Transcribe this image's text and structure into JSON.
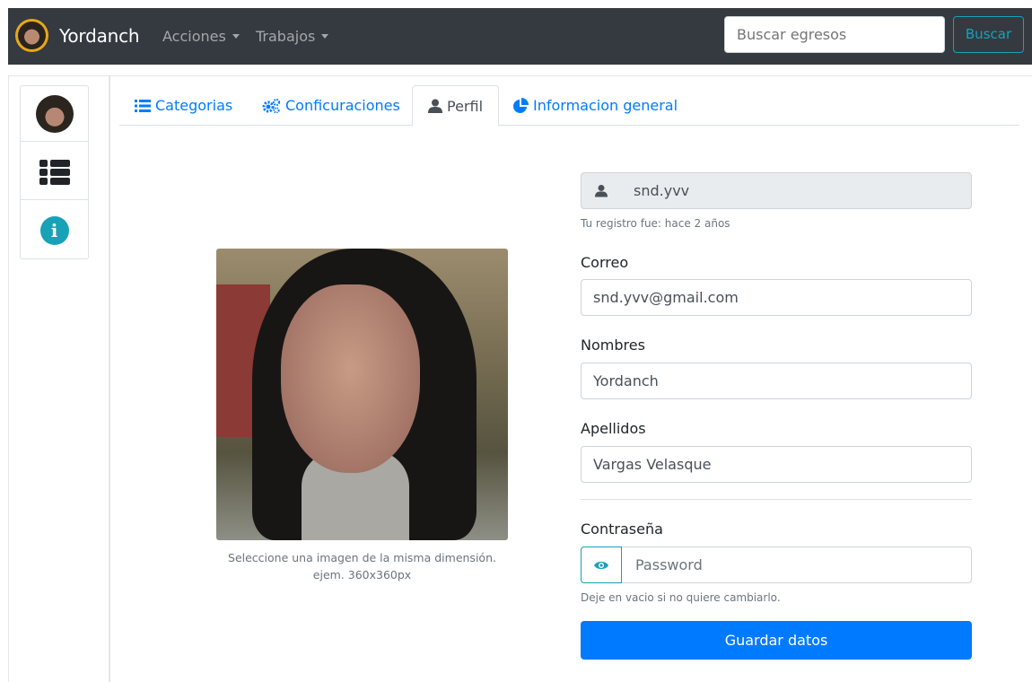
{
  "navbar": {
    "brand": "Yordanch",
    "menus": [
      {
        "label": "Acciones"
      },
      {
        "label": "Trabajos"
      }
    ],
    "search": {
      "placeholder": "Buscar egresos",
      "button_label": "Buscar"
    }
  },
  "sidebar": {
    "items": [
      {
        "icon": "user-avatar"
      },
      {
        "icon": "list-icon"
      },
      {
        "icon": "info-icon"
      }
    ]
  },
  "tabs": [
    {
      "label": "Categorias",
      "icon": "list-icon",
      "active": false
    },
    {
      "label": "Conficuraciones",
      "icon": "gears-icon",
      "active": false
    },
    {
      "label": "Perfil",
      "icon": "user-icon",
      "active": true
    },
    {
      "label": "Informacion general",
      "icon": "pie-chart-icon",
      "active": false
    }
  ],
  "profile": {
    "photo_caption_line1": "Seleccione una imagen de la misma dimensión.",
    "photo_caption_line2": "ejem. 360x360px",
    "username": "snd.yvv",
    "registered_note": "Tu registro fue: hace 2 años",
    "email_label": "Correo",
    "email_value": "snd.yvv@gmail.com",
    "names_label": "Nombres",
    "names_value": "Yordanch",
    "surnames_label": "Apellidos",
    "surnames_value": "Vargas Velasque",
    "password_label": "Contraseña",
    "password_placeholder": "Password",
    "password_hint": "Deje en vacio si no quiere cambiarlo.",
    "save_label": "Guardar datos"
  },
  "colors": {
    "navbar_bg": "#343a40",
    "primary": "#007bff",
    "info": "#17a2b8",
    "muted": "#6c757d"
  }
}
